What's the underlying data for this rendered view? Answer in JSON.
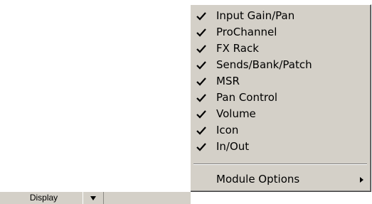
{
  "menu": {
    "items": [
      {
        "label": "Input Gain/Pan",
        "checked": true
      },
      {
        "label": "ProChannel",
        "checked": true
      },
      {
        "label": "FX Rack",
        "checked": true
      },
      {
        "label": "Sends/Bank/Patch",
        "checked": true
      },
      {
        "label": "MSR",
        "checked": true
      },
      {
        "label": "Pan Control",
        "checked": true
      },
      {
        "label": "Volume",
        "checked": true
      },
      {
        "label": "Icon",
        "checked": true
      },
      {
        "label": "In/Out",
        "checked": true
      }
    ],
    "submenu": {
      "label": "Module Options",
      "icon": "chevron-right-icon"
    }
  },
  "toolbar": {
    "display_label": "Display",
    "dropdown_icon": "chevron-down-icon"
  },
  "colors": {
    "menu_bg": "#d4d0c8",
    "text": "#000000"
  }
}
